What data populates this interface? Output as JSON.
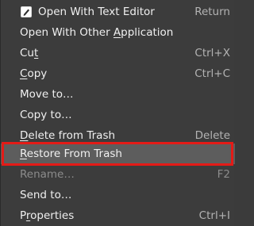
{
  "menu": {
    "items": [
      {
        "label": "Open With Text Editor",
        "shortcut": "Return",
        "icon": "text-editor-icon"
      },
      {
        "label_pre": "Open With Other ",
        "label_u": "A",
        "label_post": "pplication",
        "shortcut": ""
      },
      {
        "label_pre": "Cu",
        "label_u": "t",
        "label_post": "",
        "shortcut": "Ctrl+X"
      },
      {
        "label_pre": "",
        "label_u": "C",
        "label_post": "opy",
        "shortcut": "Ctrl+C"
      },
      {
        "label": "Move to…",
        "shortcut": ""
      },
      {
        "label": "Copy to…",
        "shortcut": ""
      },
      {
        "label_pre": "",
        "label_u": "D",
        "label_post": "elete from Trash",
        "shortcut": "Delete"
      },
      {
        "label_pre": "",
        "label_u": "R",
        "label_post": "estore From Trash",
        "shortcut": "",
        "state": "highlighted"
      },
      {
        "label": "Rename…",
        "shortcut": "F2",
        "state": "disabled"
      },
      {
        "label": "Send to…",
        "shortcut": ""
      },
      {
        "label_pre": "P",
        "label_u": "r",
        "label_post": "operties",
        "shortcut": "Ctrl+I"
      }
    ]
  },
  "colors": {
    "menu_background": "#3c3c3c",
    "highlight_background": "#5d5d5d",
    "annotation_border": "#e41b17"
  }
}
